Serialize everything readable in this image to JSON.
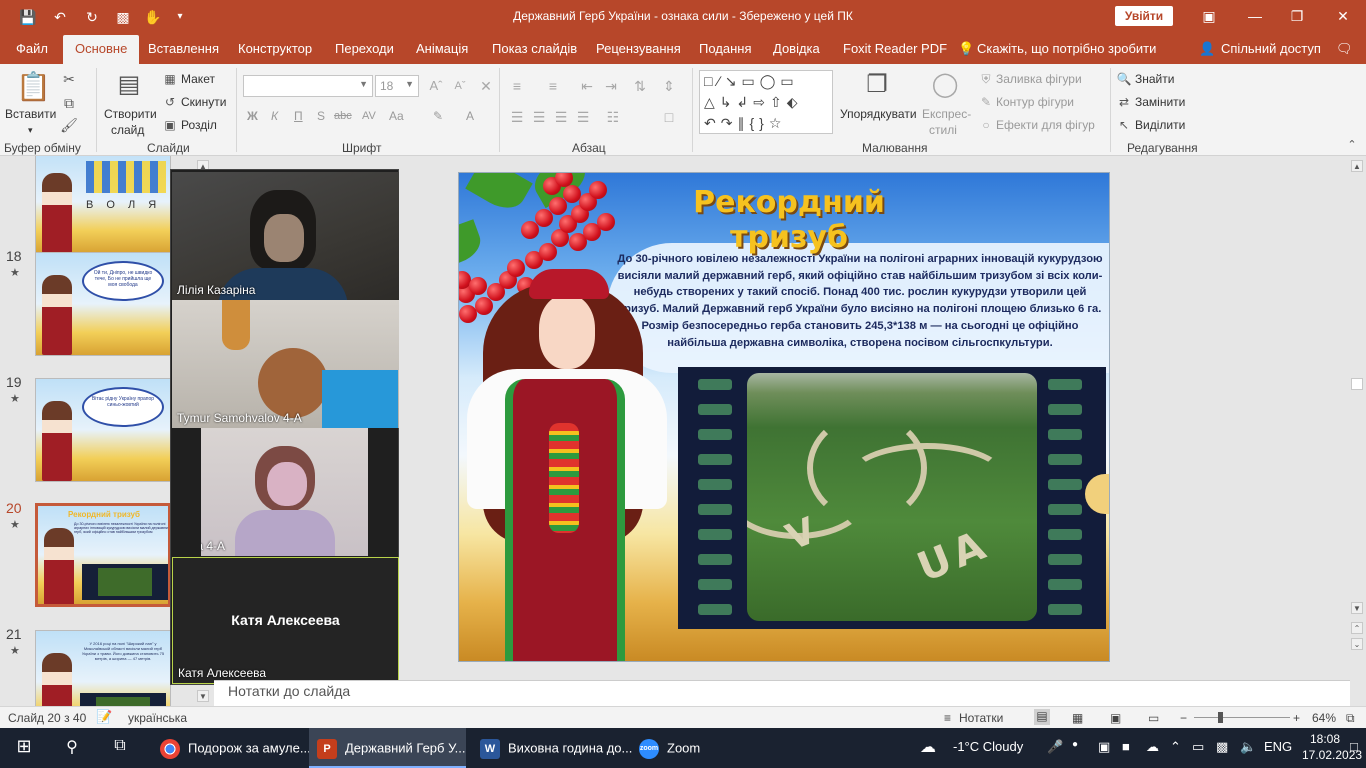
{
  "window": {
    "title": "Державний Герб України - ознака сили  -  Збережено у цей ПК",
    "signin_label": "Увійти",
    "quick_access": [
      "save-icon",
      "undo-icon",
      "redo-icon",
      "present-from-start-icon",
      "touch-mode-icon",
      "customize-icon"
    ],
    "controls": [
      "minimize",
      "restore",
      "close"
    ]
  },
  "menu": {
    "tabs": [
      "Файл",
      "Основне",
      "Вставлення",
      "Конструктор",
      "Переходи",
      "Анімація",
      "Показ слайдів",
      "Рецензування",
      "Подання",
      "Довідка",
      "Foxit Reader PDF"
    ],
    "active_tab": "Основне",
    "tell_me": "Скажіть, що потрібно зробити",
    "share": "Спільний доступ"
  },
  "ribbon": {
    "clipboard": {
      "paste": "Вставити",
      "group_label": "Буфер обміну"
    },
    "slides": {
      "new_slide_line1": "Створити",
      "new_slide_line2": "слайд",
      "layout": "Макет",
      "reset": "Скинути",
      "section": "Розділ",
      "group_label": "Слайди"
    },
    "font": {
      "font_name": "",
      "font_size": "18",
      "bold": "Ж",
      "italic": "К",
      "underline": "П",
      "strike": "abc",
      "char_spacing": "Aa",
      "group_label": "Шрифт"
    },
    "paragraph": {
      "group_label": "Абзац"
    },
    "drawing": {
      "arrange": "Упорядкувати",
      "quick_styles_line1": "Експрес-",
      "quick_styles_line2": "стилі",
      "fill": "Заливка фігури",
      "outline": "Контур фігури",
      "effects": "Ефекти для фігур",
      "group_label": "Малювання"
    },
    "editing": {
      "find": "Знайти",
      "replace": "Замінити",
      "select": "Виділити",
      "group_label": "Редагування"
    }
  },
  "thumbnails": [
    {
      "number": "",
      "style": "volya",
      "text": "В О Л Я"
    },
    {
      "number": "18",
      "style": "bubble",
      "text": "Ой ти, Дніпро, не швидко тече, Бо не прийшла ще моя свобода"
    },
    {
      "number": "19",
      "style": "bubble2",
      "text": "Вітає рідну Україну прапор синьо-жовтий"
    },
    {
      "number": "20",
      "style": "current",
      "title": "Рекордний тризуб",
      "text": "До 30-річного ювілею незалежності України на полігоні аграрних інновацій кукурудзою висіяли малий державний герб, який офіційно став найбільшим тризубом",
      "selected": true
    },
    {
      "number": "21",
      "style": "t21",
      "text": "У 2016 році на полі \"Широкий лан\" у Миколаївській області висіяли малий герб України з трави. Його довжина становить 75 метрів, а ширина — 47 метрів."
    }
  ],
  "zoom_participants": [
    {
      "name": "Лілія Казаріна"
    },
    {
      "name": "Tymur Samohvalov 4-А"
    },
    {
      "name": "Кира 4-А"
    },
    {
      "name": "Катя Алексеева",
      "camera_off": true,
      "display_name": "Катя Алексеева"
    }
  ],
  "slide": {
    "title": "Рекордний тризуб",
    "body": "До 30-річного ювілею незалежності України на полігоні аграрних інновацій кукурудзою висіяли малий державний герб, який офіційно став найбільшим тризубом зі всіх коли-небудь створених у такий спосіб. Понад 400 тис. рослин кукурудзи утворили цей тризуб. Малий Державний герб України було висіяно на полігоні площею близько 6 га. Розмір безпосередньо герба становить 245,3*138 м — на сьогодні це офіційно найбільша державна символіка, створена посівом сільгоспкультури.",
    "field_text": "UA"
  },
  "notes_placeholder": "Нотатки до слайда",
  "statusbar": {
    "slide_info": "Слайд 20 з 40",
    "language": "українська",
    "notes_label": "Нотатки",
    "zoom": "64%"
  },
  "taskbar": {
    "apps": [
      {
        "label": "Подорож за амуле...",
        "icon": "chrome-icon"
      },
      {
        "label": "Державний Герб У...",
        "icon": "powerpoint-icon",
        "active": true
      },
      {
        "label": "Виховна година до...",
        "icon": "word-icon"
      },
      {
        "label": "Zoom",
        "icon": "zoom-icon"
      }
    ],
    "weather": "-1°C  Cloudy",
    "language": "ENG",
    "time": "18:08",
    "date": "17.02.2023"
  },
  "colors": {
    "accent": "#b7472a",
    "taskbar": "#1a2230",
    "slide_title": "#f6c21f"
  }
}
